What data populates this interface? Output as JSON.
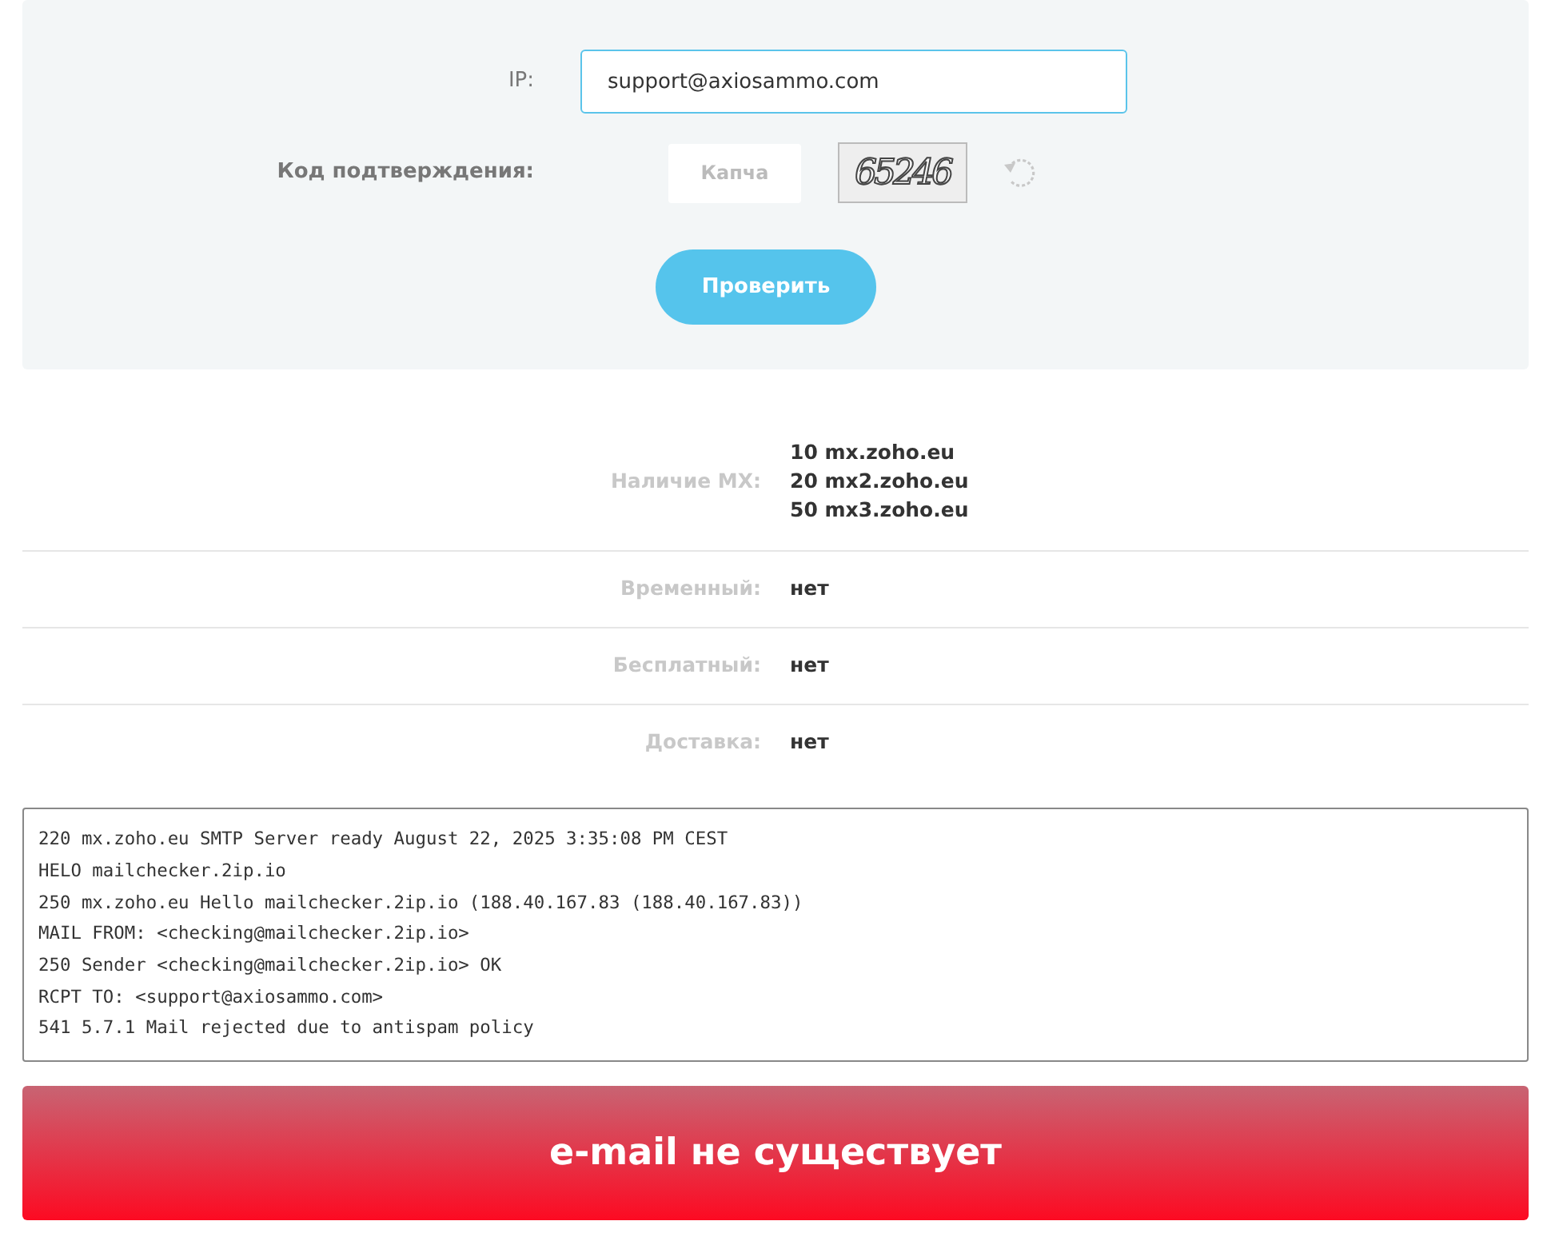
{
  "form": {
    "ip_label": "IP:",
    "ip_value": "support@axiosammo.com",
    "captcha_label": "Код подтверждения:",
    "captcha_placeholder": "Капча",
    "captcha_code": "65246",
    "submit": "Проверить"
  },
  "results": [
    {
      "label": "Наличие MX:",
      "values": [
        "**10** mx.zoho.eu",
        "**20** mx2.zoho.eu",
        "**50** mx3.zoho.eu"
      ]
    },
    {
      "label": "Временный:",
      "values": [
        "нет"
      ]
    },
    {
      "label": "Бесплатный:",
      "values": [
        "нет"
      ]
    },
    {
      "label": "Доставка:",
      "values": [
        "нет"
      ]
    }
  ],
  "log": [
    "220 mx.zoho.eu SMTP Server ready August 22, 2025 3:35:08 PM CEST",
    "HELO mailchecker.2ip.io",
    "250 mx.zoho.eu Hello mailchecker.2ip.io (188.40.167.83 (188.40.167.83))",
    "MAIL FROM: <checking@mailchecker.2ip.io>",
    "250 Sender <checking@mailchecker.2ip.io> OK",
    "RCPT TO: <support@axiosammo.com>",
    "541 5.7.1 Mail rejected due to antispam policy"
  ],
  "verdict": "e-mail не существует"
}
